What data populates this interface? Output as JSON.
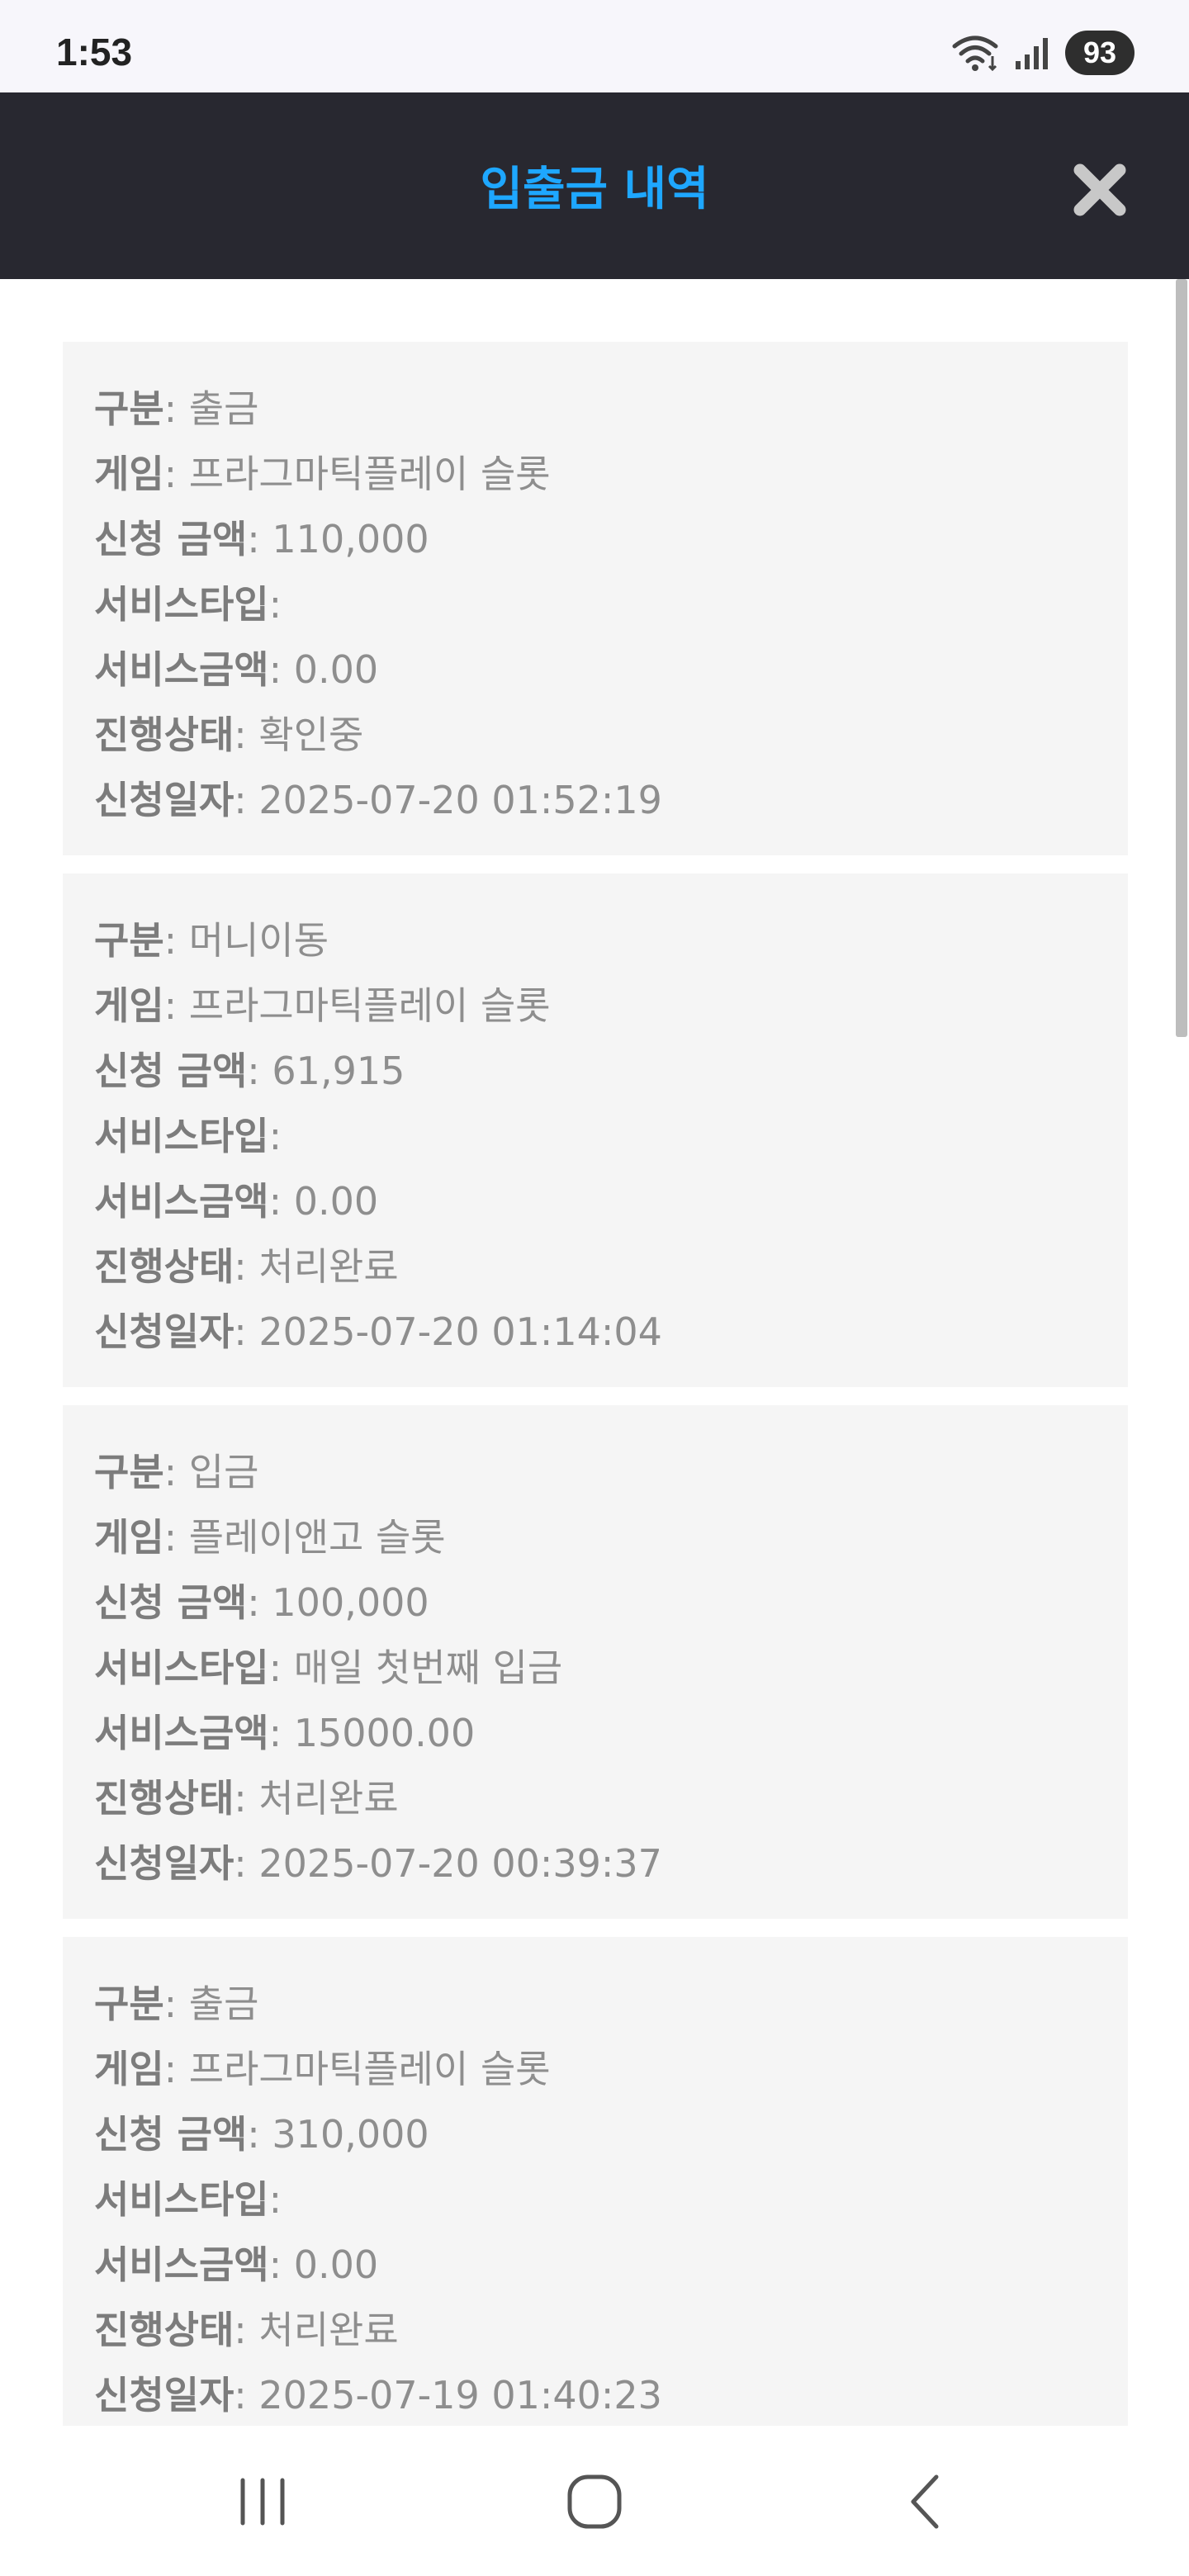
{
  "status": {
    "time": "1:53",
    "battery": "93",
    "wifi_icon": "wifi-icon",
    "signal_icon": "signal-icon"
  },
  "header": {
    "title": "입출금 내역",
    "close_icon": "close-icon"
  },
  "labels": {
    "type": "구분",
    "game": "게임",
    "amount": "신청 금액",
    "service_type": "서비스타입",
    "service_amount": "서비스금액",
    "progress": "진행상태",
    "date": "신청일자"
  },
  "transactions": [
    {
      "type": ": 출금",
      "game": ": 프라그마틱플레이 슬롯",
      "amount": ": 110,000",
      "service_type": ":",
      "service_amount": ": 0.00",
      "progress": ": 확인중",
      "date": ": 2025-07-20 01:52:19"
    },
    {
      "type": ": 머니이동",
      "game": ": 프라그마틱플레이 슬롯",
      "amount": ": 61,915",
      "service_type": ":",
      "service_amount": ": 0.00",
      "progress": ": 처리완료",
      "date": ": 2025-07-20 01:14:04"
    },
    {
      "type": ": 입금",
      "game": ": 플레이앤고 슬롯",
      "amount": ": 100,000",
      "service_type": ": 매일 첫번째 입금",
      "service_amount": ": 15000.00",
      "progress": ": 처리완료",
      "date": ": 2025-07-20 00:39:37"
    },
    {
      "type": ": 출금",
      "game": ": 프라그마틱플레이 슬롯",
      "amount": ": 310,000",
      "service_type": ":",
      "service_amount": ": 0.00",
      "progress": ": 처리완료",
      "date": ": 2025-07-19 01:40:23"
    }
  ],
  "nav": {
    "recents_icon": "recents-icon",
    "home_icon": "home-icon",
    "back_icon": "back-icon"
  }
}
